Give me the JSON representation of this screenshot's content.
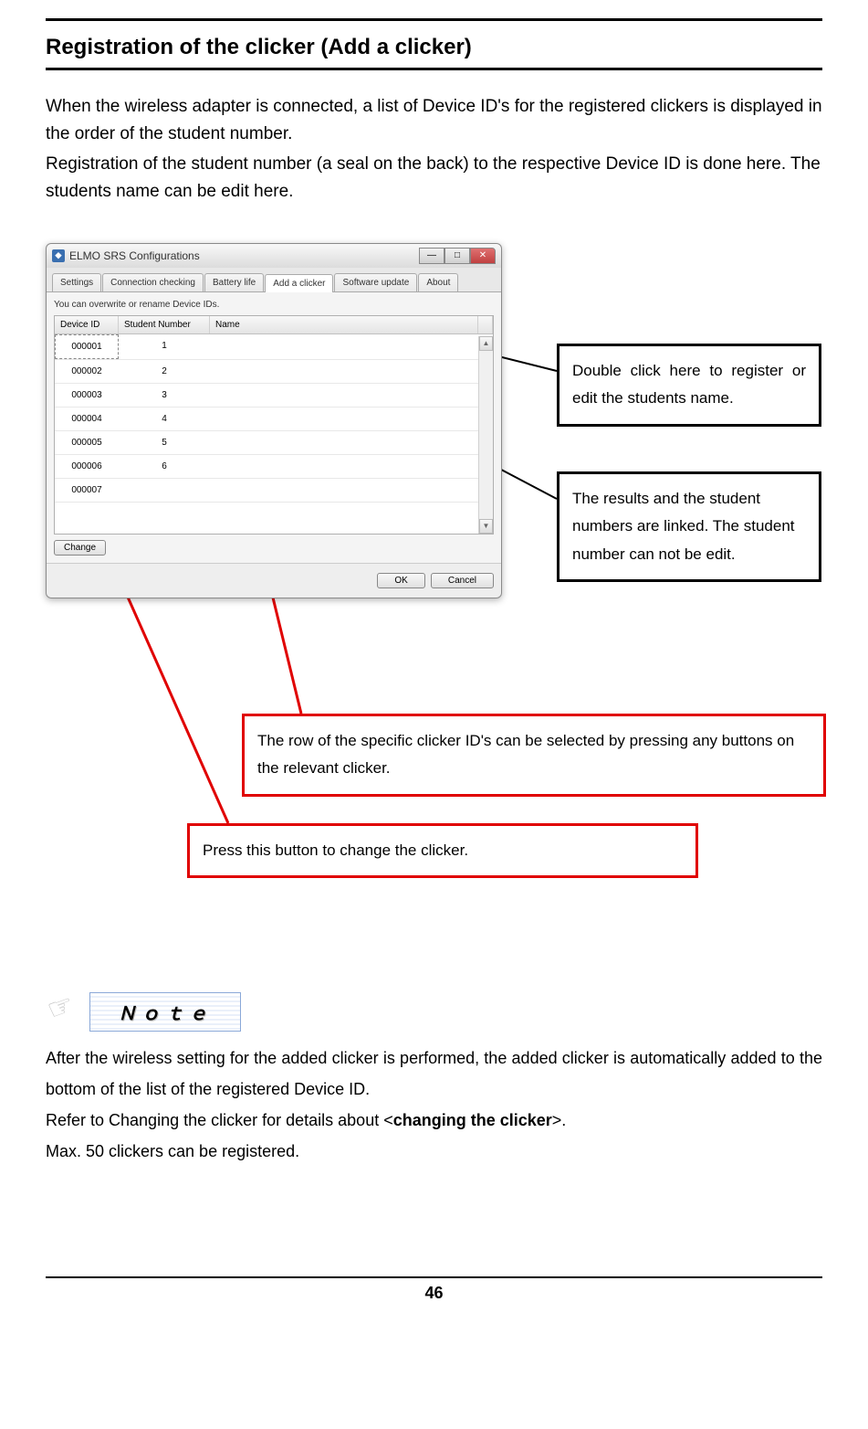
{
  "heading": "Registration of the clicker (Add a clicker)",
  "intro": {
    "p1": "When the wireless adapter is connected, a list of Device ID's for the registered clickers is displayed in the order of the student number.",
    "p2": "Registration of the student number (a seal on the back) to the respective Device ID is done here. The students name can be edit here."
  },
  "window": {
    "title": "ELMO SRS Configurations",
    "tabs": [
      "Settings",
      "Connection checking",
      "Battery life",
      "Add a clicker",
      "Software update",
      "About"
    ],
    "active_tab_index": 3,
    "hint": "You can overwrite or rename Device IDs.",
    "columns": {
      "device_id": "Device ID",
      "student_number": "Student Number",
      "name": "Name"
    },
    "rows": [
      {
        "id": "000001",
        "num": "1",
        "name": ""
      },
      {
        "id": "000002",
        "num": "2",
        "name": ""
      },
      {
        "id": "000003",
        "num": "3",
        "name": ""
      },
      {
        "id": "000004",
        "num": "4",
        "name": ""
      },
      {
        "id": "000005",
        "num": "5",
        "name": ""
      },
      {
        "id": "000006",
        "num": "6",
        "name": ""
      },
      {
        "id": "000007",
        "num": "",
        "name": ""
      }
    ],
    "change_btn": "Change",
    "ok_btn": "OK",
    "cancel_btn": "Cancel"
  },
  "callouts": {
    "c1": "Double click here to register or edit the students name.",
    "c2": "The results and the student numbers are linked. The student number can not be edit.",
    "c3": "The row of the specific clicker ID's can be selected by pressing any buttons on the relevant clicker.",
    "c4": "Press this button to change the clicker."
  },
  "note": {
    "label": "Ｎｏｔｅ",
    "p1_a": "After the wireless setting for the added clicker is performed, the added clicker is automatically added to the bottom of the list of the registered Device ID.",
    "p2_a": "Refer to Changing the clicker for details about <",
    "p2_b": "changing the clicker",
    "p2_c": ">.",
    "p3": "Max. 50 clickers can be registered."
  },
  "page_number": "46"
}
